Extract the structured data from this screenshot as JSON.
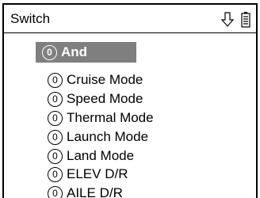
{
  "header": {
    "title": "Switch",
    "icons": [
      "down-arrow-icon",
      "battery-icon"
    ]
  },
  "list": {
    "items": [
      {
        "number": "0",
        "label": "And",
        "selected": true
      },
      {
        "number": "0",
        "label": "Cruise Mode",
        "selected": false
      },
      {
        "number": "0",
        "label": "Speed Mode",
        "selected": false
      },
      {
        "number": "0",
        "label": "Thermal Mode",
        "selected": false
      },
      {
        "number": "0",
        "label": "Launch Mode",
        "selected": false
      },
      {
        "number": "0",
        "label": "Land Mode",
        "selected": false
      },
      {
        "number": "0",
        "label": "ELEV D/R",
        "selected": false
      },
      {
        "number": "0",
        "label": "AILE D/R",
        "selected": false
      }
    ]
  },
  "colors": {
    "selection_background": "#7f7f7f",
    "text": "#000000",
    "selected_text": "#ffffff"
  }
}
